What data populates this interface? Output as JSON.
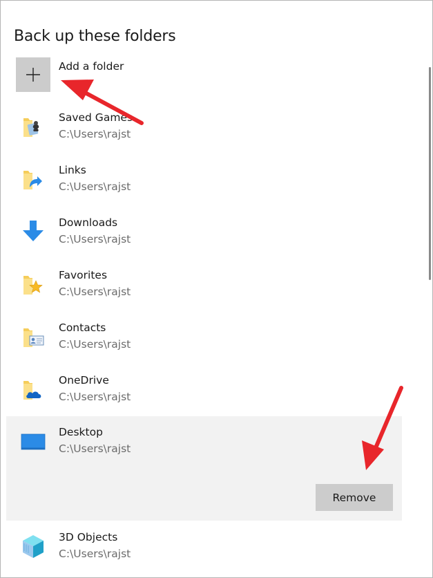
{
  "heading": "Back up these folders",
  "add_folder": {
    "label": "Add a folder"
  },
  "folders": [
    {
      "name": "Saved Games",
      "path": "C:\\Users\\rajst",
      "icon": "saved-games-folder-icon"
    },
    {
      "name": "Links",
      "path": "C:\\Users\\rajst",
      "icon": "links-folder-icon"
    },
    {
      "name": "Downloads",
      "path": "C:\\Users\\rajst",
      "icon": "download-arrow-icon"
    },
    {
      "name": "Favorites",
      "path": "C:\\Users\\rajst",
      "icon": "favorites-folder-icon"
    },
    {
      "name": "Contacts",
      "path": "C:\\Users\\rajst",
      "icon": "contacts-folder-icon"
    },
    {
      "name": "OneDrive",
      "path": "C:\\Users\\rajst",
      "icon": "onedrive-folder-icon"
    },
    {
      "name": "Desktop",
      "path": "C:\\Users\\rajst",
      "icon": "desktop-monitor-icon",
      "selected": true
    },
    {
      "name": "3D Objects",
      "path": "C:\\Users\\rajst",
      "icon": "3d-cube-icon"
    }
  ],
  "remove_label": "Remove",
  "colors": {
    "annotation_arrow": "#e8262b",
    "selected_row": "#f2f2f2",
    "button_gray": "#cccccc",
    "folder_yellow": "#f5cd5a",
    "windows_blue": "#2b8be6"
  }
}
